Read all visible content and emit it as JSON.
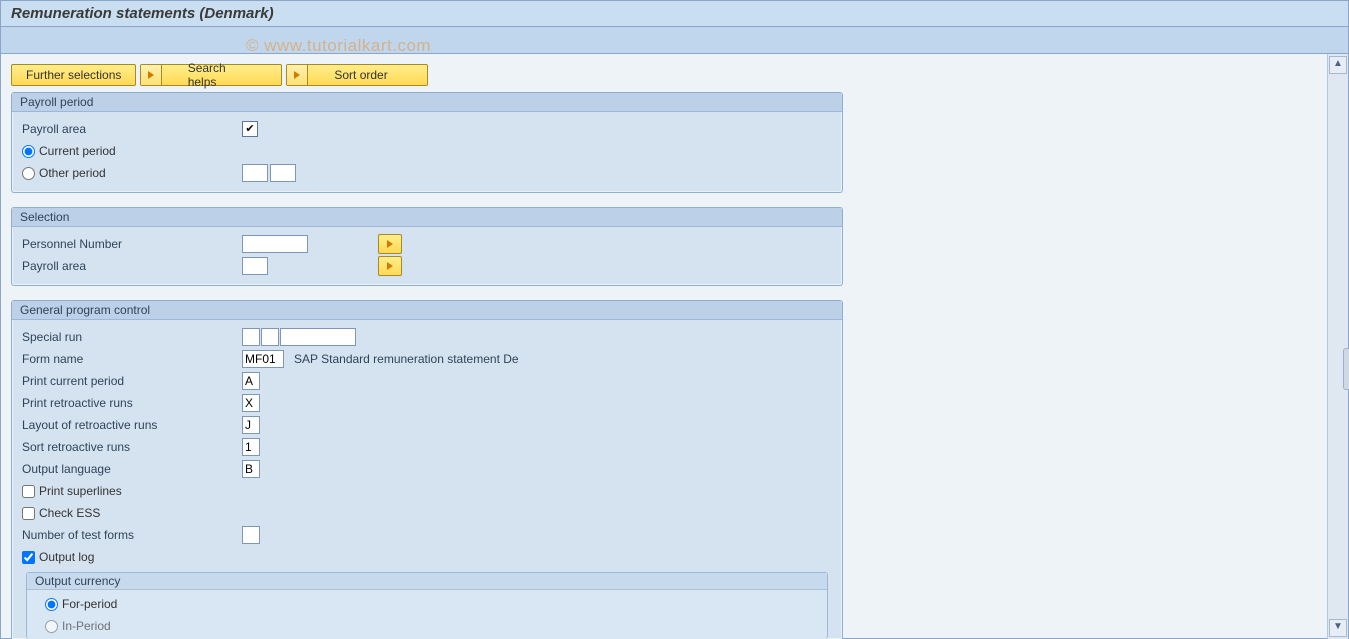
{
  "page_title": "Remuneration statements (Denmark)",
  "watermark": "©  www.tutorialkart.com",
  "buttons": {
    "further_selections": "Further selections",
    "search_helps": "Search helps",
    "sort_order": "Sort order"
  },
  "groups": {
    "payroll_period": {
      "title": "Payroll period",
      "payroll_area_label": "Payroll area",
      "payroll_area_checked": true,
      "current_period_label": "Current period",
      "other_period_label": "Other period",
      "period_selected": "current"
    },
    "selection": {
      "title": "Selection",
      "personnel_number_label": "Personnel Number",
      "payroll_area_label": "Payroll area"
    },
    "general": {
      "title": "General program control",
      "special_run_label": "Special run",
      "form_name_label": "Form name",
      "form_name_value": "MF01",
      "form_name_desc": "SAP Standard remuneration statement De",
      "print_current_period_label": "Print current period",
      "print_current_period_value": "A",
      "print_retro_label": "Print retroactive runs",
      "print_retro_value": "X",
      "layout_retro_label": "Layout of retroactive runs",
      "layout_retro_value": "J",
      "sort_retro_label": "Sort retroactive runs",
      "sort_retro_value": "1",
      "output_language_label": "Output language",
      "output_language_value": "B",
      "print_superlines_label": "Print superlines",
      "print_superlines_checked": false,
      "check_ess_label": "Check ESS",
      "check_ess_checked": false,
      "number_test_forms_label": "Number of test forms",
      "output_log_label": "Output log",
      "output_log_checked": true,
      "output_currency": {
        "title": "Output currency",
        "for_period_label": "For-period",
        "in_period_label": "In-Period",
        "selected": "for"
      }
    }
  }
}
